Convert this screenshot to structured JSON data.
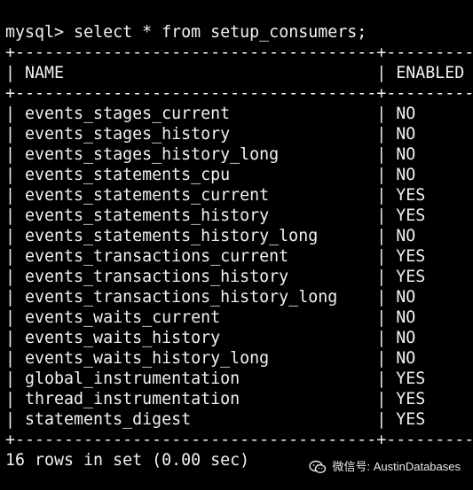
{
  "terminal": {
    "prompt": "mysql>",
    "command": "select * from setup_consumers;",
    "border": "+-------------------------------------+---------+",
    "headers": [
      "NAME",
      "ENABLED"
    ],
    "rows": [
      {
        "name": "events_stages_current",
        "enabled": "NO"
      },
      {
        "name": "events_stages_history",
        "enabled": "NO"
      },
      {
        "name": "events_stages_history_long",
        "enabled": "NO"
      },
      {
        "name": "events_statements_cpu",
        "enabled": "NO"
      },
      {
        "name": "events_statements_current",
        "enabled": "YES"
      },
      {
        "name": "events_statements_history",
        "enabled": "YES"
      },
      {
        "name": "events_statements_history_long",
        "enabled": "NO"
      },
      {
        "name": "events_transactions_current",
        "enabled": "YES"
      },
      {
        "name": "events_transactions_history",
        "enabled": "YES"
      },
      {
        "name": "events_transactions_history_long",
        "enabled": "NO"
      },
      {
        "name": "events_waits_current",
        "enabled": "NO"
      },
      {
        "name": "events_waits_history",
        "enabled": "NO"
      },
      {
        "name": "events_waits_history_long",
        "enabled": "NO"
      },
      {
        "name": "global_instrumentation",
        "enabled": "YES"
      },
      {
        "name": "thread_instrumentation",
        "enabled": "YES"
      },
      {
        "name": "statements_digest",
        "enabled": "YES"
      }
    ],
    "summary": "16 rows in set (0.00 sec)"
  },
  "watermark": {
    "icon": "wechat-icon",
    "text": "微信号: AustinDatabases"
  },
  "colors": {
    "background": "#000000",
    "text": "#f2f2f2"
  }
}
